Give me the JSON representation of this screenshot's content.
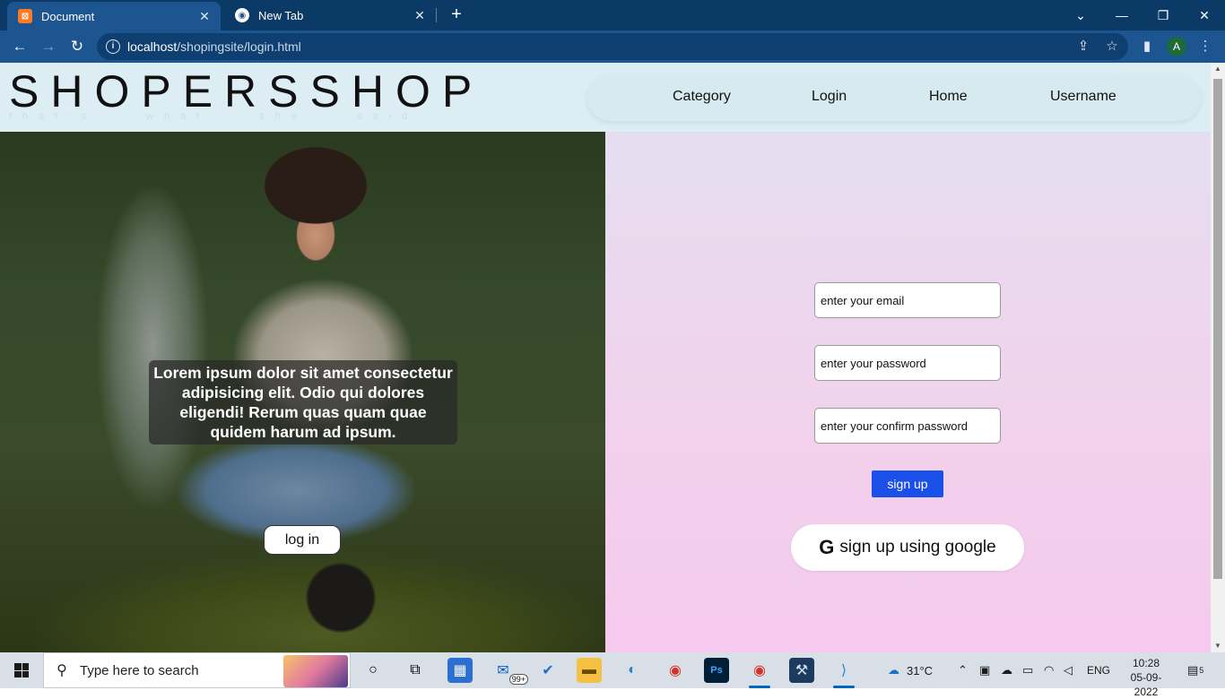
{
  "browser": {
    "tabs": [
      {
        "title": "Document",
        "close": "✕"
      },
      {
        "title": "New Tab",
        "close": "✕"
      }
    ],
    "new_tab": "+",
    "window_controls": {
      "dropdown": "⌄",
      "minimize": "—",
      "restore": "❐",
      "close": "✕"
    },
    "url_host": "localhost",
    "url_path": "/shopingsite/login.html",
    "profile_initial": "A",
    "icons": {
      "back": "arrow-left-icon",
      "forward": "arrow-right-icon",
      "reload": "reload-icon",
      "info": "info-icon",
      "share": "share-icon",
      "star": "star-icon",
      "sidebar": "sidebar-icon",
      "menu": "kebab-menu-icon"
    }
  },
  "site": {
    "brand": "SHOPERSSHOP",
    "tagline": "that's what she said",
    "nav": [
      "Category",
      "Login",
      "Home",
      "Username"
    ]
  },
  "hero": {
    "text": "Lorem ipsum dolor sit amet consectetur adipisicing elit. Odio qui dolores eligendi! Rerum quas quam quae quidem harum ad ipsum.",
    "button": "log in"
  },
  "form": {
    "email_placeholder": "enter your email",
    "password_placeholder": "enter your password",
    "confirm_placeholder": "enter your confirm password",
    "signup_button": "sign up",
    "google_button": "sign up using google",
    "google_letter": "G"
  },
  "colors": {
    "tabbar": "#0c3a66",
    "toolbar": "#1c5590",
    "header_bg": "#dcedf4",
    "signup_button": "#1a4fe8",
    "form_gradient_top": "#e6def0",
    "form_gradient_bottom": "#f6c9ee"
  },
  "taskbar": {
    "search_placeholder": "Type here to search",
    "mail_badge": "99+",
    "weather": "31°C",
    "language": "ENG",
    "time": "10:28",
    "date": "05-09-2022",
    "notification_count": "5"
  }
}
